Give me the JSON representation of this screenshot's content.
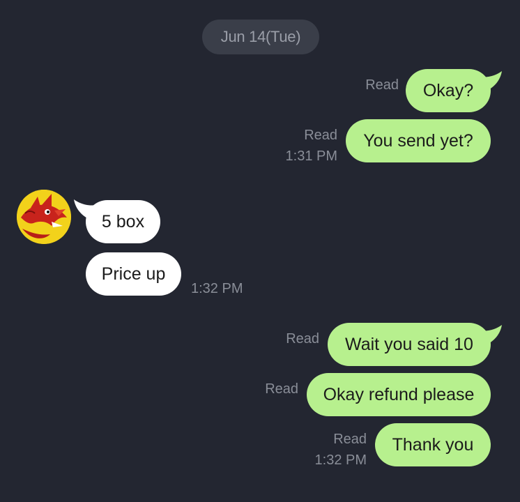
{
  "date_separator": "Jun 14(Tue)",
  "colors": {
    "background": "#232631",
    "outgoing_bubble": "#b7f08e",
    "incoming_bubble": "#ffffff",
    "meta_text": "#8a8e98"
  },
  "messages": [
    {
      "direction": "outgoing",
      "text": "Okay?",
      "read": "Read",
      "time": ""
    },
    {
      "direction": "outgoing",
      "text": "You send yet?",
      "read": "Read",
      "time": "1:31 PM"
    },
    {
      "direction": "incoming",
      "text": "5 box",
      "time": ""
    },
    {
      "direction": "incoming",
      "text": "Price up",
      "time": "1:32 PM"
    },
    {
      "direction": "outgoing",
      "text": "Wait you said 10",
      "read": "Read",
      "time": ""
    },
    {
      "direction": "outgoing",
      "text": "Okay refund please",
      "read": "Read",
      "time": ""
    },
    {
      "direction": "outgoing",
      "text": "Thank you",
      "read": "Read",
      "time": "1:32 PM"
    }
  ],
  "contact": {
    "avatar_icon": "dragon-avatar-icon"
  }
}
